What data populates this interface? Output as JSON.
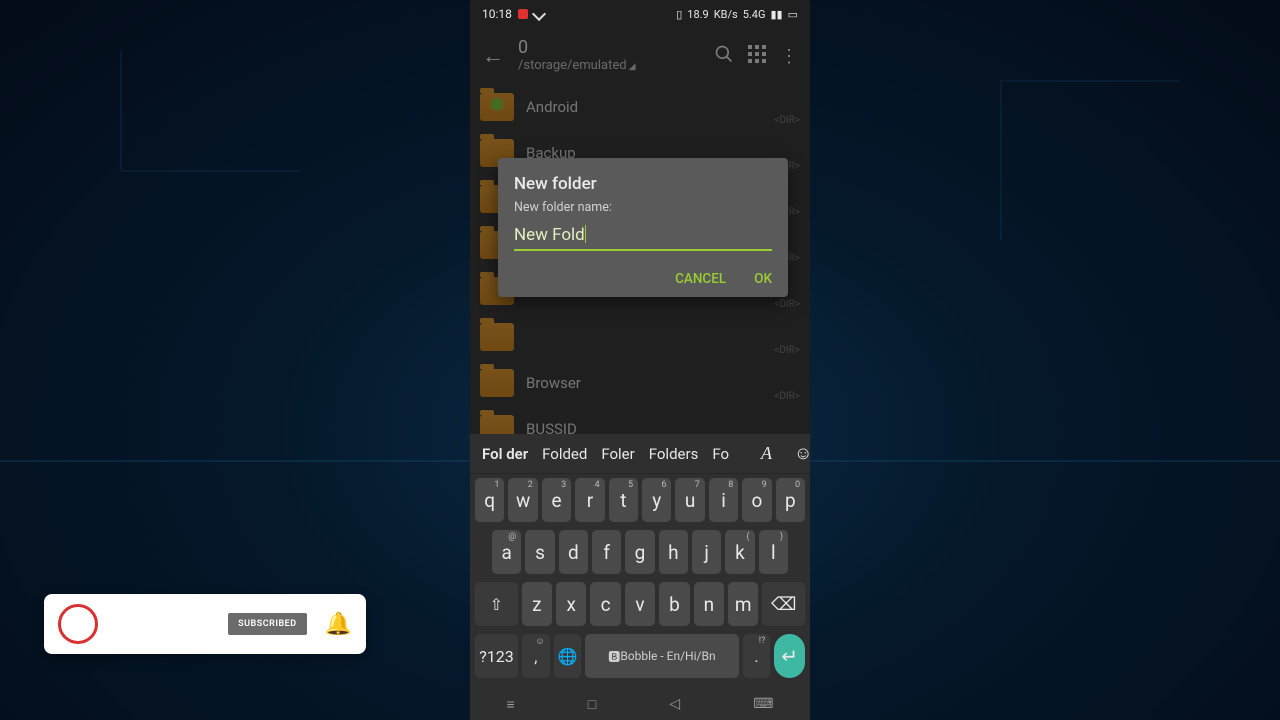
{
  "statusbar": {
    "time": "10:18",
    "net1": "18.9",
    "net2": "KB/s",
    "net3": "5.4G",
    "sig": "📶",
    "batt": "▢"
  },
  "appbar": {
    "title": "0",
    "path": "/storage/emulated"
  },
  "folders": [
    {
      "name": "Android"
    },
    {
      "name": "Backup"
    },
    {
      "name": ""
    },
    {
      "name": ""
    },
    {
      "name": ""
    },
    {
      "name": ""
    },
    {
      "name": "Browser"
    },
    {
      "name": "BUSSID"
    }
  ],
  "dir_tag": "<DIR>",
  "dialog": {
    "title": "New folder",
    "label": "New folder name:",
    "value": "New Fold",
    "cancel": "CANCEL",
    "ok": "OK"
  },
  "suggestions": [
    "Fol der",
    "Folded",
    "Foler",
    "Folders",
    "Fo"
  ],
  "kbd": {
    "row1": [
      [
        "q",
        "1"
      ],
      [
        "w",
        "2"
      ],
      [
        "e",
        "3"
      ],
      [
        "r",
        "4"
      ],
      [
        "t",
        "5"
      ],
      [
        "y",
        "6"
      ],
      [
        "u",
        "7"
      ],
      [
        "i",
        "8"
      ],
      [
        "o",
        "9"
      ],
      [
        "p",
        "0"
      ]
    ],
    "row2": [
      [
        "a",
        "@"
      ],
      [
        "s",
        ""
      ],
      [
        "d",
        ""
      ],
      [
        "f",
        ""
      ],
      [
        "g",
        ""
      ],
      [
        "h",
        ""
      ],
      [
        "j",
        ""
      ],
      [
        "k",
        "("
      ],
      [
        "l",
        ")"
      ]
    ],
    "row3": [
      "z",
      "x",
      "c",
      "v",
      "b",
      "n",
      "m"
    ],
    "sym": "?123",
    "space": "Bobble - En/Hi/Bn",
    "dot_sup": "!?",
    "comma_sup": "☺"
  },
  "subscribe": {
    "label": "SUBSCRIBED"
  }
}
